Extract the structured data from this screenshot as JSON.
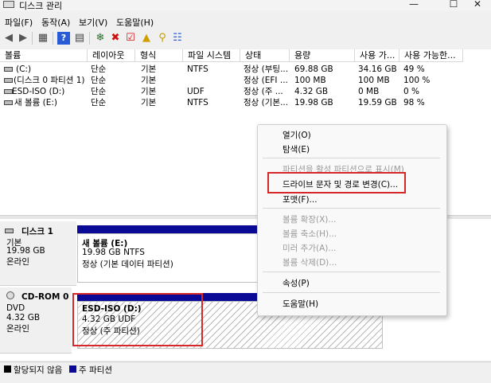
{
  "window": {
    "title": "디스크 관리",
    "min": "—",
    "max": "☐",
    "close": "✕"
  },
  "menu": [
    "파일(F)",
    "동작(A)",
    "보기(V)",
    "도움말(H)"
  ],
  "table": {
    "headers": [
      "볼륨",
      "레이아웃",
      "형식",
      "파일 시스템",
      "상태",
      "용량",
      "사용 가...",
      "사용 가능한..."
    ],
    "rows": [
      [
        "(C:)",
        "단순",
        "기본",
        "NTFS",
        "정상 (부팅...",
        "69.88 GB",
        "34.16 GB",
        "49 %"
      ],
      [
        "(디스크 0 파티션 1)",
        "단순",
        "기본",
        "",
        "정상 (EFI ...",
        "100 MB",
        "100 MB",
        "100 %"
      ],
      [
        "ESD-ISO (D:)",
        "단순",
        "기본",
        "UDF",
        "정상 (주 ...",
        "4.32 GB",
        "0 MB",
        "0 %"
      ],
      [
        "새 볼륨 (E:)",
        "단순",
        "기본",
        "NTFS",
        "정상 (기본...",
        "19.98 GB",
        "19.59 GB",
        "98 %"
      ]
    ]
  },
  "disks": [
    {
      "name": "디스크 1",
      "type": "기본",
      "size": "19.98 GB",
      "status": "온라인",
      "partition": {
        "name": "새 볼륨  (E:)",
        "size": "19.98 GB NTFS",
        "status": "정상 (기본 데이터 파티션)"
      }
    },
    {
      "name": "CD-ROM 0",
      "type": "DVD",
      "size": "4.32 GB",
      "status": "온라인",
      "partition": {
        "name": "ESD-ISO  (D:)",
        "size": "4.32 GB UDF",
        "status": "정상 (주 파티션)"
      }
    }
  ],
  "legend": {
    "unallocated": "할당되지 않음",
    "primary": "주 파티션"
  },
  "context_menu": {
    "open": "열기(O)",
    "explore": "탐색(E)",
    "mark_active": "파티션을 활성 파티션으로 표시(M)",
    "change_letter": "드라이브 문자 및 경로 변경(C)...",
    "format": "포맷(F)...",
    "extend": "볼륨 확장(X)...",
    "shrink": "볼륨 축소(H)...",
    "add_mirror": "미러 추가(A)...",
    "delete": "볼륨 삭제(D)...",
    "properties": "속성(P)",
    "help": "도움말(H)"
  },
  "colors": {
    "primary_partition": "#0a0a96",
    "unallocated": "#000000",
    "highlight": "#d62828"
  }
}
